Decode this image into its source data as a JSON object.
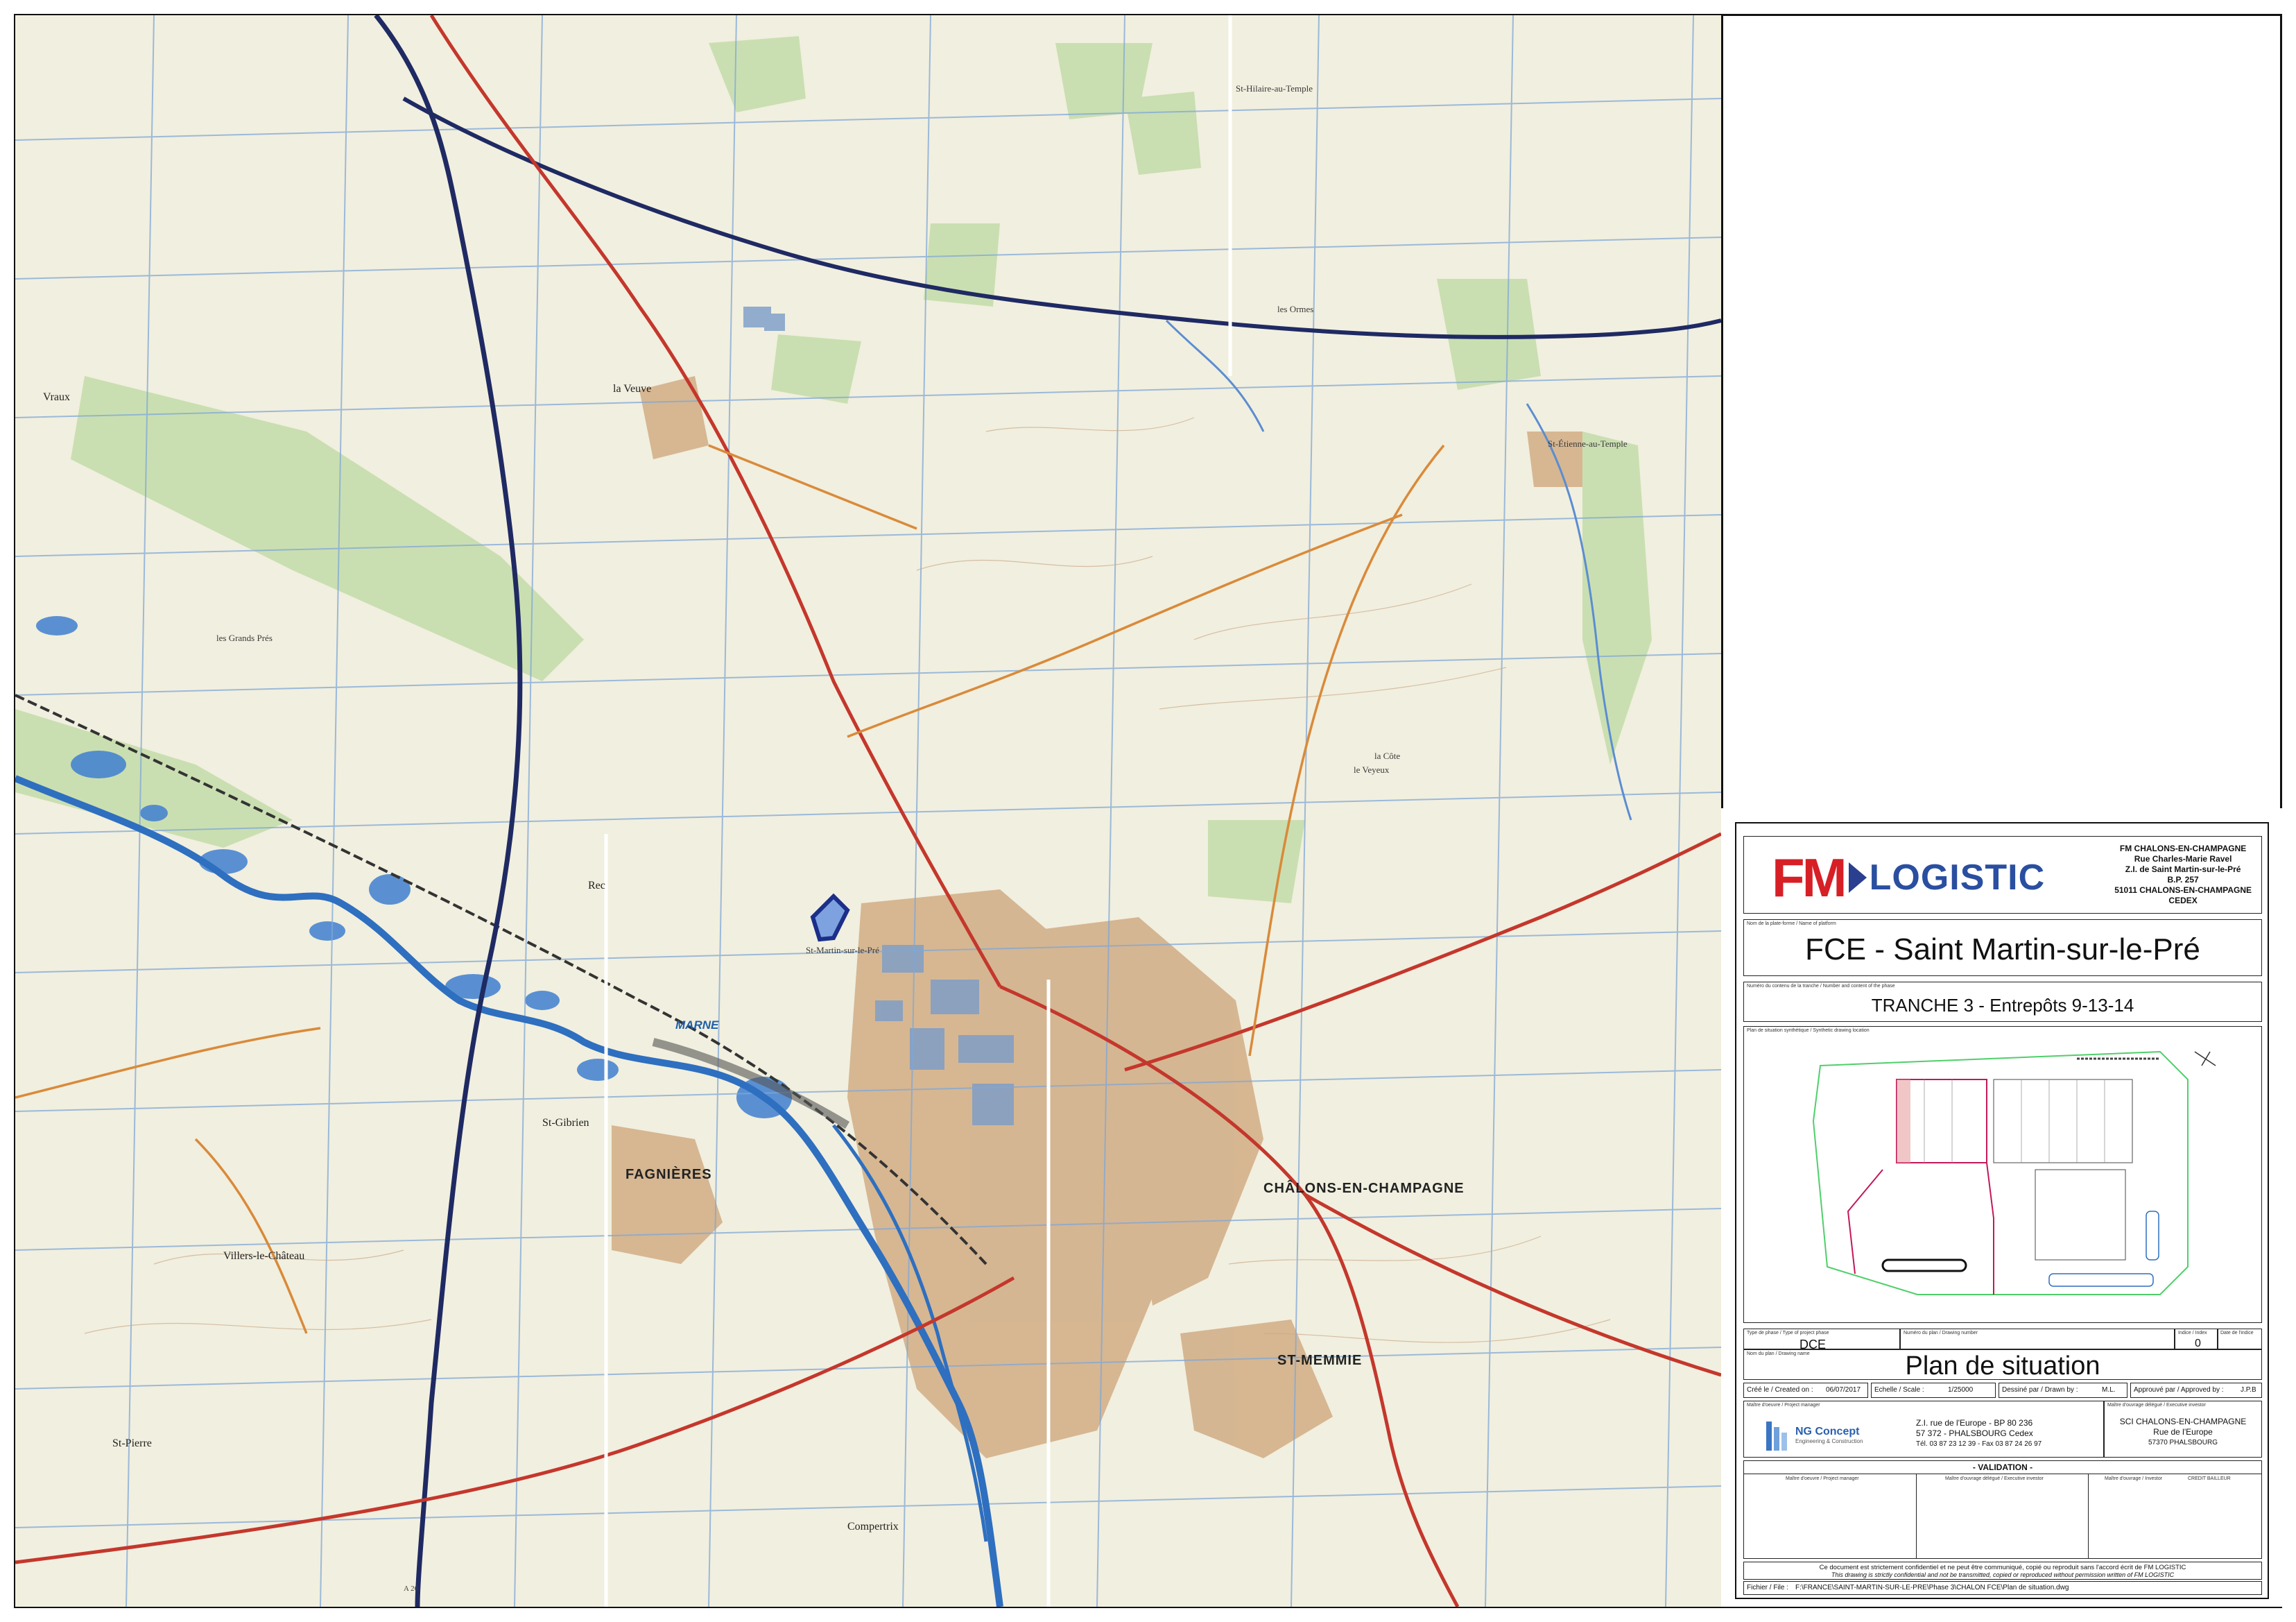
{
  "map": {
    "labels": {
      "vraux": "Vraux",
      "la_veuve": "la Veuve",
      "st_hilaire": "St-Hilaire-au-Temple",
      "st_etienne": "St-Étienne-au-Temple",
      "st_martin": "St-Martin-sur-le-Pré",
      "fagnieres": "FAGNIÈRES",
      "chalons": "CHÂLONS-EN-CHAMPAGNE",
      "st_memmie": "ST-MEMMIE",
      "compertrix": "Compertrix",
      "st_gibrien": "St-Gibrien",
      "villers": "Villers-le-Château",
      "st_pierre": "St-Pierre",
      "marne": "MARNE",
      "les_grands_pres": "les Grands Prés",
      "la_cote": "la Côte",
      "les_ormes": "les Ormes",
      "le_veyeux": "le Veyeux",
      "rec": "Rec",
      "a26": "A 26"
    }
  },
  "cartouche": {
    "logo": {
      "fm": "FM",
      "logistic": "LOGISTIC"
    },
    "address": [
      "FM CHALONS-EN-CHAMPAGNE",
      "Rue Charles-Marie Ravel",
      "Z.I. de Saint Martin-sur-le-Pré",
      "B.P. 257",
      "51011 CHALONS-EN-CHAMPAGNE",
      "CEDEX"
    ],
    "platform_label": "Nom de la plate-forme / Name of platform",
    "platform_name": "FCE - Saint Martin-sur-le-Pré",
    "phase_label": "Numéro du contenu de la tranche / Number and content of the phase",
    "phase_name": "TRANCHE 3 - Entrepôts 9-13-14",
    "plan_label": "Plan de situation synthétique / Synthetic drawing location",
    "phase_type_label": "Type de phase / Type of project phase",
    "phase_type": "DCE",
    "drawing_number_label": "Numéro du plan / Drawing number",
    "index_label": "Indice / Index",
    "index_value": "0",
    "date_label_small": "Date de l'indice",
    "drawing_name_label": "Nom du plan / Drawing name",
    "drawing_name": "Plan de situation",
    "created_label": "Créé le / Created on :",
    "created_value": "06/07/2017",
    "scale_label": "Echelle / Scale :",
    "scale_value": "1/25000",
    "drawn_label": "Dessiné par / Drawn by :",
    "drawn_value": "M.L.",
    "approved_label": "Approuvé par / Approved by :",
    "approved_value": "J.P.B",
    "pm_label": "Maître d'oeuvre / Project manager",
    "ng_name": "NG Concept",
    "ng_sub": "Engineering & Construction",
    "ng_addr": [
      "Z.I. rue de l'Europe - BP 80 236",
      "57 372 - PHALSBOURG Cedex",
      "Tél. 03 87 23 12 39 - Fax 03 87 24 26 97"
    ],
    "owner_label": "Maître d'ouvrage délégué / Executive investor",
    "owner_addr": [
      "SCI CHALONS-EN-CHAMPAGNE",
      "Rue de l'Europe",
      "57370 PHALSBOURG"
    ],
    "validation_title": "- VALIDATION -",
    "validation_cols": [
      "Maître d'oeuvre / Project manager",
      "Maître d'ouvrage délégué / Executive investor",
      "Maître d'ouvrage / Investor",
      "CREDIT BAILLEUR"
    ],
    "confidential_fr": "Ce document est strictement confidentiel et ne peut être communiqué, copié ou reproduit sans l'accord écrit de FM LOGISTIC",
    "confidential_en": "This drawing is strictly confidential and not be transmitted, copied or reproduced without permission written of FM LOGISTIC",
    "file_label": "Fichier / File :",
    "file_value": "F:\\FRANCE\\SAINT-MARTIN-SUR-LE-PRE\\Phase 3\\CHALON FCE\\Plan de situation.dwg"
  },
  "colors": {
    "grid": "#7fa7d8",
    "road_red": "#c4372c",
    "road_orange": "#d98a3a",
    "water": "#2e6fc0",
    "forest": "#b7d7a0",
    "urban": "#c9a27a",
    "brand_red": "#d71f26",
    "brand_blue": "#2a4fa0",
    "site_outline": "#1b2f8a"
  }
}
